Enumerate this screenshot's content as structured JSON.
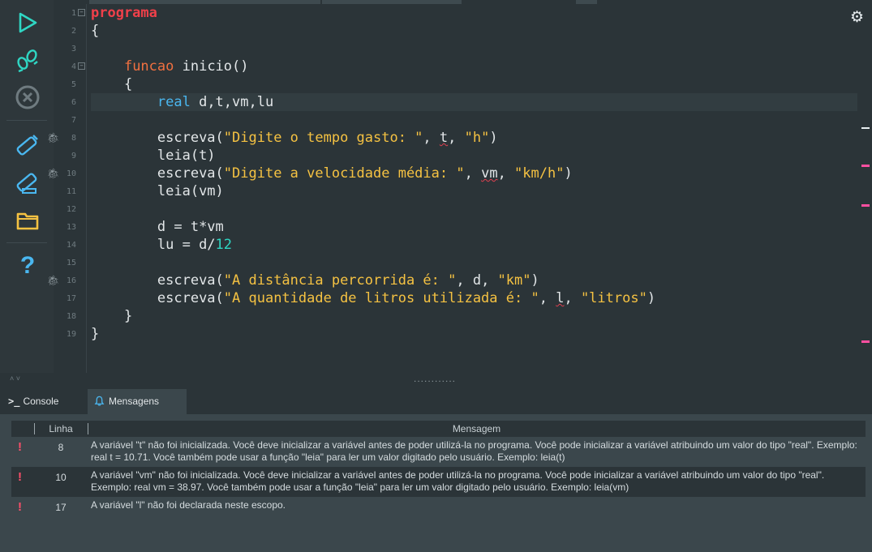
{
  "toolbar": {
    "items": [
      {
        "name": "run-icon"
      },
      {
        "name": "step-debug-icon"
      },
      {
        "name": "stop-icon"
      },
      {
        "name": "usb-device-icon"
      },
      {
        "name": "usb-config-icon"
      },
      {
        "name": "folder-icon"
      },
      {
        "name": "help-icon",
        "glyph": "?"
      }
    ]
  },
  "editor": {
    "line_numbers": [
      "1",
      "2",
      "3",
      "4",
      "5",
      "6",
      "7",
      "8",
      "9",
      "10",
      "11",
      "12",
      "13",
      "14",
      "15",
      "16",
      "17",
      "18",
      "19"
    ],
    "lines": {
      "l1": "programa",
      "l2": "{",
      "l4a": "funcao",
      "l4b": " inicio()",
      "l5": "{",
      "l6a": "real",
      "l6b": " d,t,vm,lu",
      "l8a": "escreva(",
      "l8b": "\"Digite o tempo gasto: \"",
      "l8c": ", ",
      "l8d": "t",
      "l8e": ", ",
      "l8f": "\"h\"",
      "l8g": ")",
      "l9": "leia(t)",
      "l10a": "escreva(",
      "l10b": "\"Digite a velocidade média: \"",
      "l10c": ", ",
      "l10d": "vm",
      "l10e": ", ",
      "l10f": "\"km/h\"",
      "l10g": ")",
      "l11": "leia(vm)",
      "l13": "d = t*vm",
      "l14a": "lu = d/",
      "l14b": "12",
      "l16a": "escreva(",
      "l16b": "\"A distância percorrida é: \"",
      "l16c": ", d, ",
      "l16d": "\"km\"",
      "l16e": ")",
      "l17a": "escreva(",
      "l17b": "\"A quantidade de litros utilizada é: \"",
      "l17c": ", ",
      "l17d": "l",
      "l17e": ", ",
      "l17f": "\"litros\"",
      "l17g": ")",
      "l18": "}",
      "l19": "}"
    },
    "settings_icon": "⚙"
  },
  "splitter": {
    "dots": "............"
  },
  "tabs": {
    "console_icon": ">_",
    "console_label": "Console",
    "messages_icon": "🔔",
    "messages_label": "Mensagens"
  },
  "messages": {
    "header": {
      "line": "Linha",
      "message": "Mensagem"
    },
    "rows": [
      {
        "icon": "!",
        "line": "8",
        "text": "A variável \"t\" não foi inicializada. Você deve inicializar a variável antes de poder utilizá-la no programa. Você pode inicializar a variável atribuindo um valor do tipo \"real\". Exemplo: real t = 10.71. Você também pode usar a função \"leia\" para ler um valor digitado pelo usuário. Exemplo: leia(t)"
      },
      {
        "icon": "!",
        "line": "10",
        "text": "A variável \"vm\" não foi inicializada. Você deve inicializar a variável antes de poder utilizá-la no programa. Você pode inicializar a variável atribuindo um valor do tipo \"real\". Exemplo: real vm = 38.97. Você também pode usar a função \"leia\" para ler um valor digitado pelo usuário. Exemplo: leia(vm)"
      },
      {
        "icon": "!",
        "line": "17",
        "text": "A variável \"l\" não foi declarada neste escopo."
      }
    ]
  },
  "colors": {
    "keyword_red": "#f0404a",
    "keyword_orange": "#f07040",
    "keyword_blue": "#4ab7f0",
    "string": "#f5c242",
    "number": "#2fd6c3",
    "error_marker": "#ff4fa0"
  }
}
